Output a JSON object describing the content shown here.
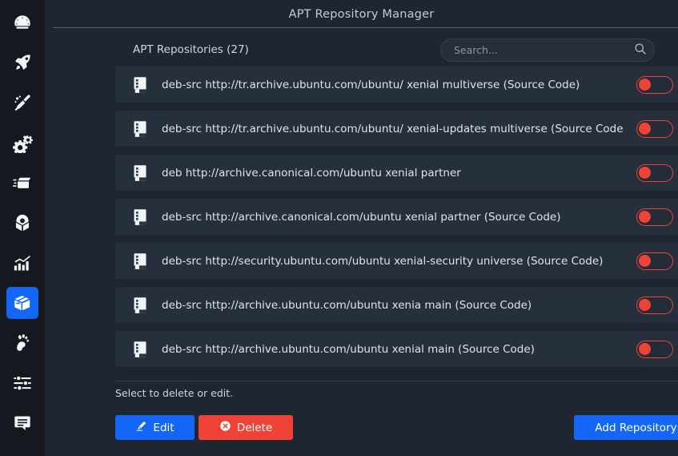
{
  "window": {
    "title": "APT Repository Manager"
  },
  "sidebar": {
    "active_index": 7,
    "active_color": "#1466f5",
    "items": [
      {
        "icon": "dashboard-gauge-icon",
        "label": "Dashboard"
      },
      {
        "icon": "rocket-icon",
        "label": "Boost"
      },
      {
        "icon": "broom-icon",
        "label": "Cleaner"
      },
      {
        "icon": "gears-icon",
        "label": "Services"
      },
      {
        "icon": "boot-loader-icon",
        "label": "Boot"
      },
      {
        "icon": "disk-icon",
        "label": "Disk"
      },
      {
        "icon": "bar-chart-icon",
        "label": "Monitor"
      },
      {
        "icon": "package-box-icon",
        "label": "Packages"
      },
      {
        "icon": "gnome-foot-icon",
        "label": "Desktop"
      },
      {
        "icon": "sliders-icon",
        "label": "Tweaks"
      },
      {
        "icon": "chat-icon",
        "label": "Feedback"
      }
    ]
  },
  "header": {
    "list_title": "APT Repositories (27)",
    "count": 27
  },
  "search": {
    "placeholder": "Search...",
    "value": "",
    "icon": "search-icon"
  },
  "repositories": [
    {
      "icon": "repo-file-icon",
      "label": "deb-src http://tr.archive.ubuntu.com/ubuntu/ xenial multiverse (Source Code)",
      "enabled": false
    },
    {
      "icon": "repo-file-icon",
      "label": "deb-src http://tr.archive.ubuntu.com/ubuntu/ xenial-updates multiverse (Source Code",
      "enabled": false
    },
    {
      "icon": "repo-file-icon",
      "label": "deb http://archive.canonical.com/ubuntu xenial partner",
      "enabled": false
    },
    {
      "icon": "repo-file-icon",
      "label": "deb-src http://archive.canonical.com/ubuntu xenial partner (Source Code)",
      "enabled": false
    },
    {
      "icon": "repo-file-icon",
      "label": "deb-src http://security.ubuntu.com/ubuntu xenial-security universe (Source Code)",
      "enabled": false
    },
    {
      "icon": "repo-file-icon",
      "label": "deb-src http://archive.ubuntu.com/ubuntu xenia main (Source Code)",
      "enabled": false
    },
    {
      "icon": "repo-file-icon",
      "label": "deb-src http://archive.ubuntu.com/ubuntu xenial main (Source Code)",
      "enabled": false
    }
  ],
  "footer": {
    "hint": "Select to delete or edit.",
    "edit_label": "Edit",
    "delete_label": "Delete",
    "add_label": "Add Repository",
    "edit_icon": "pencil-icon",
    "delete_icon": "x-circle-icon"
  },
  "colors": {
    "page_background": "#1e2631",
    "sidebar_background": "#15191f",
    "row_background": "#26303d",
    "accent_blue": "#1466f5",
    "danger_red": "#f04337",
    "text_primary": "#dde4ec",
    "text_muted": "#8b97a4"
  }
}
